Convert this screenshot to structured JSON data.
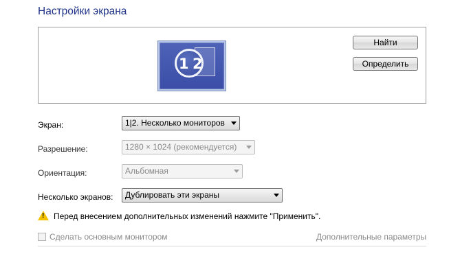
{
  "window": {
    "title": "Настройки экрана"
  },
  "preview": {
    "monitor_label": "1|2",
    "digit_left": "1",
    "digit_right": "2"
  },
  "buttons": {
    "find": "Найти",
    "identify": "Определить"
  },
  "fields": {
    "display": {
      "label": "Экран:",
      "value": "1|2. Несколько мониторов"
    },
    "resolution": {
      "label": "Разрешение:",
      "value": "1280 × 1024 (рекомендуется)"
    },
    "orientation": {
      "label": "Ориентация:",
      "value": "Альбомная"
    },
    "multiple_displays": {
      "label": "Несколько экранов:",
      "value": "Дублировать эти экраны"
    }
  },
  "warning": {
    "text": "Перед внесением дополнительных изменений нажмите \"Применить\"."
  },
  "footer": {
    "main_monitor_checkbox": "Сделать основным монитором",
    "advanced_link": "Дополнительные параметры"
  },
  "colors": {
    "title": "#1e3287",
    "monitor": "#4e62b7",
    "warning": "#f2c200"
  }
}
